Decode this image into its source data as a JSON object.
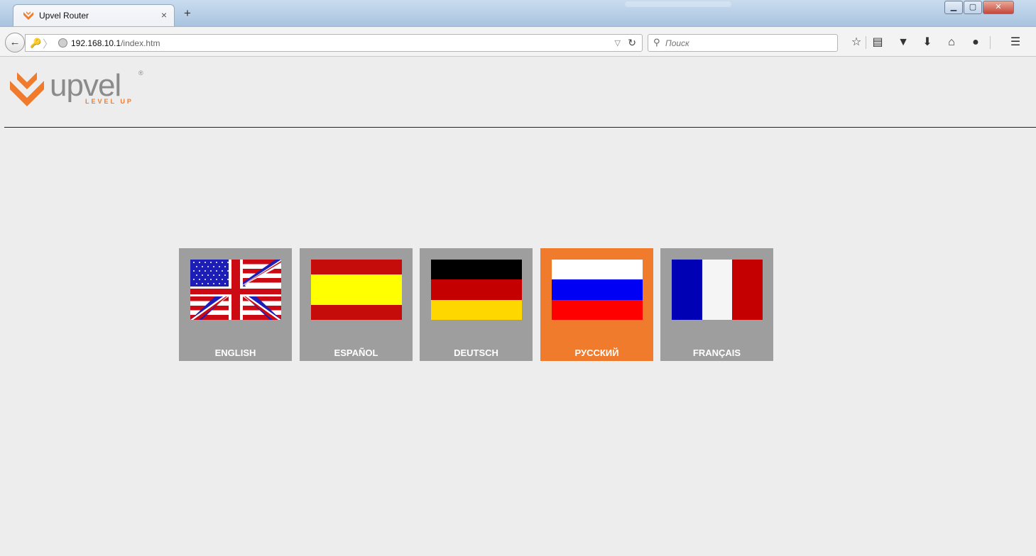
{
  "browser": {
    "tab_title": "Upvel Router",
    "tab_close": "×",
    "new_tab": "+",
    "url_host": "192.168.10.1",
    "url_path": "/index.htm",
    "search_placeholder": "Поиск",
    "window_buttons": {
      "minimize": "▁",
      "restore": "▢",
      "close": "✕"
    }
  },
  "logo": {
    "brand": "upvel",
    "registered": "®",
    "tagline": "LEVEL UP"
  },
  "languages": [
    {
      "label": "ENGLISH",
      "flag": "us-uk",
      "selected": false
    },
    {
      "label": "ESPAÑOL",
      "flag": "spain",
      "selected": false
    },
    {
      "label": "DEUTSCH",
      "flag": "germany",
      "selected": false
    },
    {
      "label": "РУССКИЙ",
      "flag": "russia",
      "selected": true
    },
    {
      "label": "FRANÇAIS",
      "flag": "france",
      "selected": false
    }
  ],
  "colors": {
    "accent": "#f07b2c",
    "tile": "#9e9e9e",
    "background": "#ededed"
  }
}
